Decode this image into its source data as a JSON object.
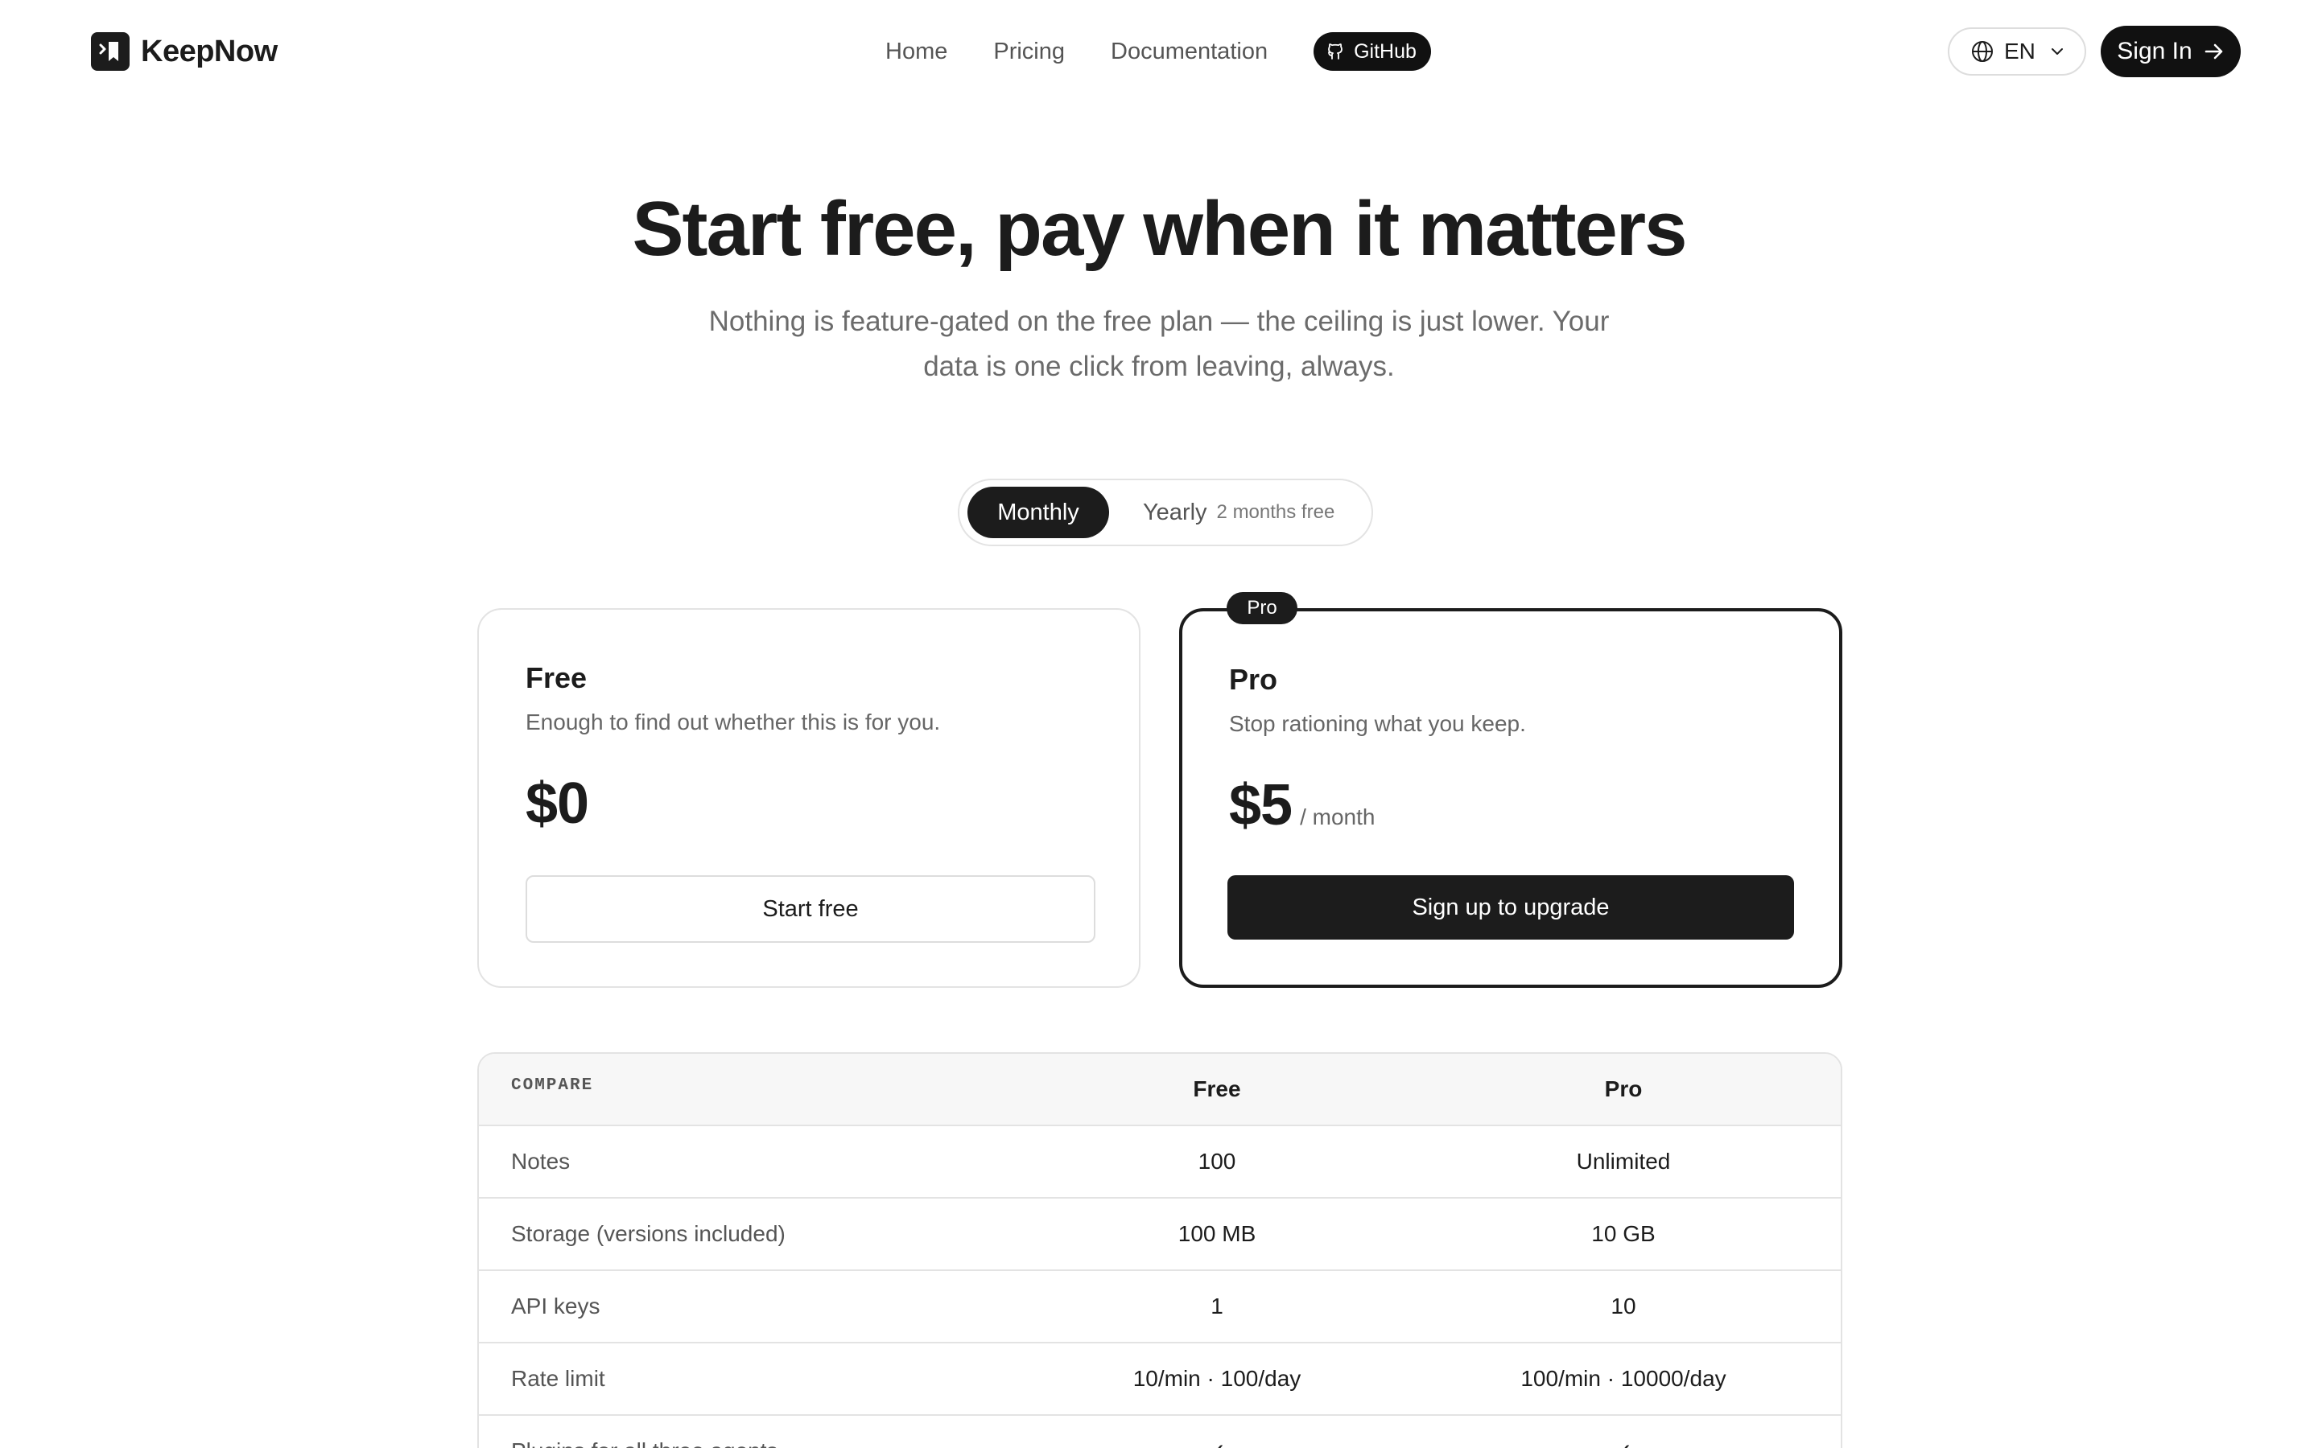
{
  "brand": {
    "name": "KeepNow",
    "logo_icon": "bookmark-icon"
  },
  "nav": {
    "items": [
      {
        "label": "Home"
      },
      {
        "label": "Pricing"
      },
      {
        "label": "Documentation"
      }
    ],
    "github_label": "GitHub",
    "github_icon": "github-icon"
  },
  "header": {
    "language_label": "EN",
    "language_icon": "globe-icon",
    "signin_label": "Sign In",
    "signin_icon": "arrow-right-icon"
  },
  "hero": {
    "title": "Start free, pay when it matters",
    "subtitle_line1": "Nothing is feature-gated on the free plan — the ceiling is just lower. Your",
    "subtitle_line2": "data is one click from leaving, always."
  },
  "billing_toggle": {
    "monthly_label": "Monthly",
    "yearly_label": "Yearly",
    "yearly_badge": "2 months free",
    "selected": "Monthly"
  },
  "plans": {
    "free": {
      "name": "Free",
      "description": "Enough to find out whether this is for you.",
      "price": "$0",
      "button_label": "Start free"
    },
    "pro": {
      "tag": "Pro",
      "name": "Pro",
      "description": "Stop rationing what you keep.",
      "price": "$5",
      "period": "/ month",
      "button_label": "Sign up to upgrade"
    }
  },
  "compare": {
    "header_label": "COMPARE",
    "col_free": "Free",
    "col_pro": "Pro",
    "rows": [
      {
        "label": "Notes",
        "free": "100",
        "pro": "Unlimited"
      },
      {
        "label": "Storage (versions included)",
        "free": "100 MB",
        "pro": "10 GB"
      },
      {
        "label": "API keys",
        "free": "1",
        "pro": "10"
      },
      {
        "label": "Rate limit",
        "free": "10/min · 100/day",
        "pro": "100/min · 10000/day"
      },
      {
        "label": "Plugins for all three agents",
        "free": "✓",
        "pro": "✓"
      }
    ]
  },
  "colors": {
    "ink": "#1c1c1c",
    "muted": "#6b6b6b",
    "border": "#e3e3e3",
    "check": "#2b6fd6"
  }
}
